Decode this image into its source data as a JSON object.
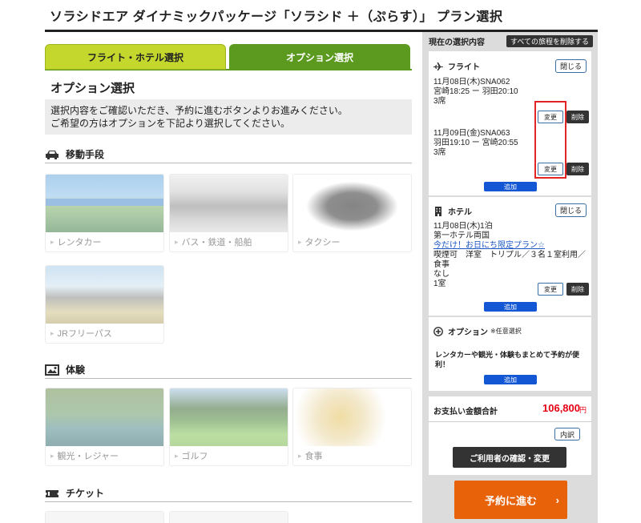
{
  "page_title": "ソラシドエア ダイナミックパッケージ「ソラシド ＋（ぷらす）」 プラン選択",
  "tabs": [
    {
      "label": "フライト・ホテル選択",
      "active": false
    },
    {
      "label": "オプション選択",
      "active": true
    }
  ],
  "section_title": "オプション選択",
  "notice": {
    "line1": "選択内容をご確認いただき、予約に進むボタンよりお進みください。",
    "line2": "ご希望の方はオプションを下記より選択してください。"
  },
  "categories": {
    "transport": {
      "title": "移動手段",
      "icon": "car-icon",
      "items": [
        "レンタカー",
        "バス・鉄道・船舶",
        "タクシー",
        "JRフリーパス"
      ]
    },
    "experience": {
      "title": "体験",
      "icon": "picture-icon",
      "items": [
        "観光・レジャー",
        "ゴルフ",
        "食事"
      ]
    },
    "ticket": {
      "title": "チケット",
      "icon": "ticket-icon"
    }
  },
  "sidebar": {
    "header": "現在の選択内容",
    "delete_all": "すべての旅程を削除する",
    "flight": {
      "title": "フライト",
      "close": "閉じる",
      "legs": [
        {
          "date_flight": "11月08日(木)SNA062",
          "route": "宮崎18:25 ー 羽田20:10",
          "seats": "3席"
        },
        {
          "date_flight": "11月09日(金)SNA063",
          "route": "羽田19:10 ー 宮崎20:55",
          "seats": "3席"
        }
      ],
      "change": "変更",
      "delete": "削除",
      "add": "追加"
    },
    "hotel": {
      "title": "ホテル",
      "close": "閉じる",
      "date": "11月08日(木)1泊",
      "name": "第一ホテル両国",
      "plan_link": "今だけ！お日にち限定プラン☆",
      "room": "喫煙可　洋室　トリプル／３名１室利用／食事",
      "meal": "なし",
      "rooms": "1室",
      "change": "変更",
      "delete": "削除",
      "add": "追加"
    },
    "option": {
      "title": "オプション",
      "note": "※任意選択",
      "promo": "レンタカーや観光・体験もまとめて予約が便利！",
      "add": "追加"
    },
    "total": {
      "label": "お支払い金額合計",
      "value": "106,800",
      "unit": "円",
      "breakdown": "内訳"
    },
    "user_button": "ご利用者の確認・変更",
    "reserve_button": "予約に進む",
    "reserve_arrow": "›"
  }
}
